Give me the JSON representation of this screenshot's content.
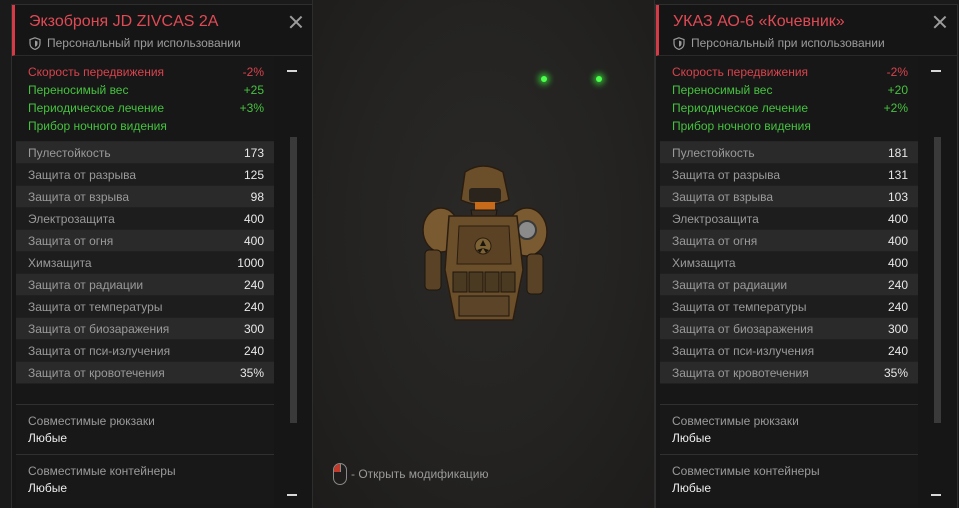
{
  "left_panel": {
    "title": "Экзоброня JD ZIVCAS 2A",
    "subtitle": "Персональный при использовании",
    "effects": [
      {
        "label": "Скорость передвижения",
        "value": "-2%",
        "color": "#d8434d"
      },
      {
        "label": "Переносимый вес",
        "value": "+25",
        "color": "#46c23f"
      },
      {
        "label": "Периодическое лечение",
        "value": "+3%",
        "color": "#46c23f"
      },
      {
        "label": "Прибор ночного видения",
        "value": "",
        "color": "#46c23f"
      }
    ],
    "stats": [
      {
        "label": "Пулестойкость",
        "value": "173"
      },
      {
        "label": "Защита от разрыва",
        "value": "125"
      },
      {
        "label": "Защита от взрыва",
        "value": "98"
      },
      {
        "label": "Электрозащита",
        "value": "400"
      },
      {
        "label": "Защита от огня",
        "value": "400"
      },
      {
        "label": "Химзащита",
        "value": "1000"
      },
      {
        "label": "Защита от радиации",
        "value": "240"
      },
      {
        "label": "Защита от температуры",
        "value": "240"
      },
      {
        "label": "Защита от биозаражения",
        "value": "300"
      },
      {
        "label": "Защита от пси-излучения",
        "value": "240"
      },
      {
        "label": "Защита от кровотечения",
        "value": "35%"
      }
    ],
    "compat": [
      {
        "label": "Совместимые рюкзаки",
        "value": "Любые"
      },
      {
        "label": "Совместимые контейнеры",
        "value": "Любые"
      }
    ]
  },
  "right_panel": {
    "title": "УКАЗ АО-6 «Кочевник»",
    "subtitle": "Персональный при использовании",
    "effects": [
      {
        "label": "Скорость передвижения",
        "value": "-2%",
        "color": "#d8434d"
      },
      {
        "label": "Переносимый вес",
        "value": "+20",
        "color": "#46c23f"
      },
      {
        "label": "Периодическое лечение",
        "value": "+2%",
        "color": "#46c23f"
      },
      {
        "label": "Прибор ночного видения",
        "value": "",
        "color": "#46c23f"
      }
    ],
    "stats": [
      {
        "label": "Пулестойкость",
        "value": "181"
      },
      {
        "label": "Защита от разрыва",
        "value": "131"
      },
      {
        "label": "Защита от взрыва",
        "value": "103"
      },
      {
        "label": "Электрозащита",
        "value": "400"
      },
      {
        "label": "Защита от огня",
        "value": "400"
      },
      {
        "label": "Химзащита",
        "value": "400"
      },
      {
        "label": "Защита от радиации",
        "value": "240"
      },
      {
        "label": "Защита от температуры",
        "value": "240"
      },
      {
        "label": "Защита от биозаражения",
        "value": "300"
      },
      {
        "label": "Защита от пси-излучения",
        "value": "240"
      },
      {
        "label": "Защита от кровотечения",
        "value": "35%"
      }
    ],
    "compat": [
      {
        "label": "Совместимые рюкзаки",
        "value": "Любые"
      },
      {
        "label": "Совместимые контейнеры",
        "value": "Любые"
      }
    ]
  },
  "center": {
    "hint": "- Открыть модификацию",
    "icons": {
      "hint": "mouse-icon",
      "armor": "armor-preview-icon"
    }
  },
  "colors": {
    "accent": "#d43b47",
    "positive": "#46c23f",
    "negative": "#d8434d",
    "led": "#4cff4c"
  }
}
